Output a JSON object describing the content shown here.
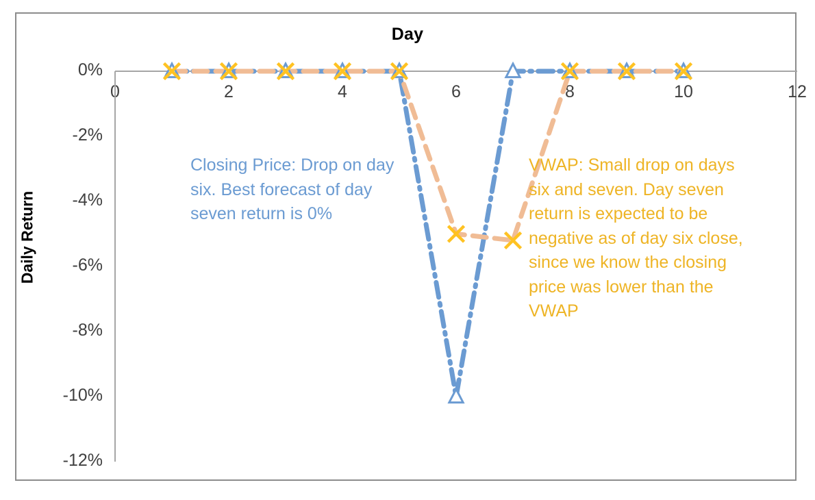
{
  "chart_data": {
    "type": "line",
    "title": "Day",
    "xlabel": "Day",
    "ylabel": "Daily Return",
    "x": [
      1,
      2,
      3,
      4,
      5,
      6,
      7,
      8,
      9,
      10
    ],
    "xlim": [
      0,
      12
    ],
    "ylim": [
      -12,
      0
    ],
    "xticks": [
      "0",
      "2",
      "4",
      "6",
      "8",
      "10",
      "12"
    ],
    "xtick_values": [
      0,
      2,
      4,
      6,
      8,
      10,
      12
    ],
    "yticks": [
      "0%",
      "-2%",
      "-4%",
      "-6%",
      "-8%",
      "-10%",
      "-12%"
    ],
    "ytick_values": [
      0,
      -2,
      -4,
      -6,
      -8,
      -10,
      -12
    ],
    "grid": false,
    "legend": "none",
    "series": [
      {
        "name": "Closing Price",
        "color": "#6b9bd2",
        "marker": "triangle-open",
        "marker_color": "#6b9bd2",
        "linestyle": "dash-dot",
        "values": [
          0,
          0,
          0,
          0,
          0,
          -10,
          0,
          0,
          0,
          0
        ]
      },
      {
        "name": "VWAP",
        "color": "#f0bc95",
        "marker": "x",
        "marker_color": "#ffc222",
        "linestyle": "dashed",
        "values": [
          0,
          0,
          0,
          0,
          0,
          -5.0,
          -5.2,
          0,
          0,
          0
        ]
      }
    ],
    "annotations": [
      {
        "name": "closing-price-note",
        "text": "Closing Price: Drop on day six. Best forecast of day seven return is 0%",
        "color": "#6b9bd2"
      },
      {
        "name": "vwap-note",
        "text": "VWAP: Small drop on days six and seven. Day seven return is expected to be negative as of day six close, since we know the closing price was lower than the VWAP",
        "color": "#eeb425"
      }
    ]
  },
  "axes": {
    "x_title": "Day",
    "y_title": "Daily Return"
  },
  "colors": {
    "closing_price": "#6b9bd2",
    "vwap_line": "#f0bc95",
    "vwap_marker": "#ffc222",
    "axis": "#a6a6a6",
    "frame": "#8c8c8c",
    "tick_text": "#404040"
  }
}
